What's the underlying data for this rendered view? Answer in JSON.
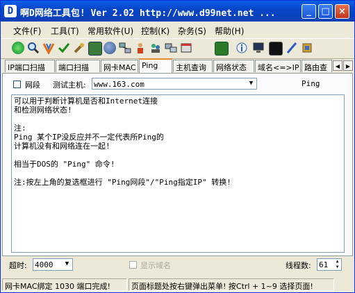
{
  "window": {
    "title": "啊D网络工具包! Ver 2.02  http://www.d99net.net ...",
    "app_icon_letter": "D",
    "minimize_glyph": "_",
    "maximize_glyph": "□",
    "close_glyph": "×"
  },
  "menu": [
    {
      "label": "文件(F)"
    },
    {
      "label": "工具(T)"
    },
    {
      "label": "常用软件(U)"
    },
    {
      "label": "控制(K)"
    },
    {
      "label": "杂务(S)"
    },
    {
      "label": "帮助(H)"
    }
  ],
  "toolbar_icons": [
    "green-globe-icon",
    "search-icon",
    "shield-v-icon",
    "check-icon",
    "wrench-icon",
    "image-icon",
    "globe-icon",
    "network-icon",
    "user-icon",
    "users-search-icon",
    "computers-icon",
    "settings-window-icon",
    "network-card-icon",
    "info-icon",
    "monitor-icon",
    "terminal-icon",
    "pen-icon",
    "puzzle-icon"
  ],
  "tabs": [
    {
      "label": "IP端口扫描"
    },
    {
      "label": "端口扫描"
    },
    {
      "label": "网卡MAC"
    },
    {
      "label": "Ping",
      "active": true
    },
    {
      "label": "主机查询"
    },
    {
      "label": "网络状态"
    },
    {
      "label": "域名<=>IP"
    },
    {
      "label": "路由查"
    }
  ],
  "tab_scroll": {
    "left": "◀",
    "right": "▶"
  },
  "ping": {
    "segment_checkbox_label": "网段",
    "host_label": "测试主机:",
    "host_value": "www.163.com",
    "action_button": "Ping",
    "output_lines": [
      "可以用于判断计算机是否和Internet连接",
      "和检测网络状态!",
      "",
      "注:",
      "Ping 某个IP没反应并不一定代表所Ping的",
      "计算机没有和网络连在一起!",
      "",
      "相当于DOS的 \"Ping\" 命令!",
      "",
      "注:按左上角的复选框进行 \"Ping网段\"/\"Ping指定IP\" 转换!"
    ]
  },
  "bottom": {
    "timeout_label": "超时:",
    "timeout_value": "4000",
    "show_domain_label": "显示域名",
    "threads_label": "线程数:",
    "threads_value": "61"
  },
  "status": {
    "left": "网卡MAC绑定 1030 端口完成!",
    "right": "页面标题处按右键弹出菜单! 按Ctrl + 1~9 选择页面!"
  },
  "colors": {
    "title_blue": "#0846c8",
    "tab_active_accent": "#e68b2c",
    "window_bg": "#ece9d8"
  }
}
